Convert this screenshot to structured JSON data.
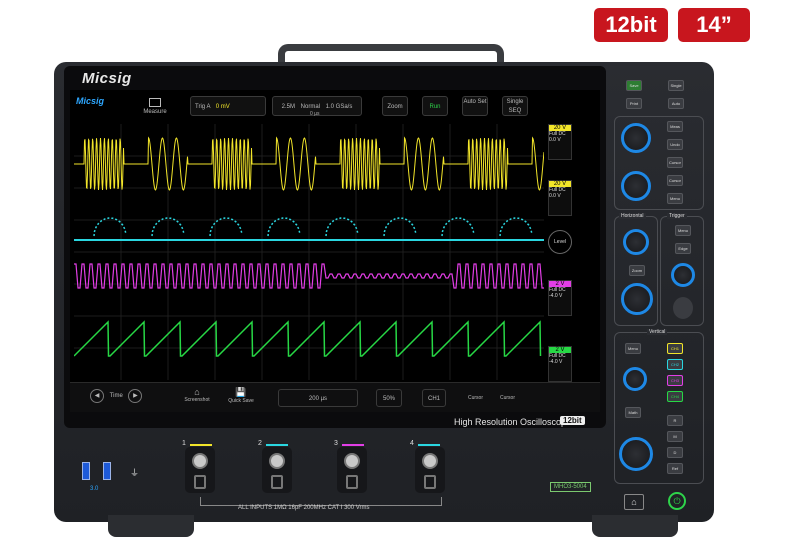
{
  "badges": {
    "bit": "12bit",
    "size": "14”"
  },
  "brand": "Micsig",
  "screen": {
    "logo": "Micsig",
    "measure_label": "Measure",
    "trigger": {
      "label": "Trig A",
      "value": "0 mV"
    },
    "timebase": {
      "samples": "2.5M",
      "mode": "Normal",
      "rate": "1.0 GSa/s",
      "delay": "0 µs"
    },
    "buttons": {
      "zoom": "Zoom",
      "run": "Run",
      "auto": "Auto Set",
      "single": "Single SEQ"
    },
    "channels": [
      {
        "scale": "20 V",
        "coupling": "Full DC",
        "offset": "0.0 V",
        "color": "#f2e52a"
      },
      {
        "scale": "20 V",
        "coupling": "Full DC",
        "offset": "0.0 V",
        "color": "#2ad6e0"
      },
      {
        "scale": "2 V",
        "coupling": "Full DC",
        "offset": "-4.0 V",
        "color": "#e23ee6"
      },
      {
        "scale": "2 V",
        "coupling": "Full DC",
        "offset": "-4.0 V",
        "color": "#27d845"
      }
    ],
    "level_label": "Level",
    "bottom": {
      "time": "Time",
      "horizontal": "200 µs",
      "percent": "50%",
      "cursor": "Cursor",
      "screenshot": "Screenshot",
      "quicksave": "Quick Save",
      "ch_off": "CH1"
    }
  },
  "subtitle": "High Resolution Oscilloscope",
  "subtitle_badge": "12bit",
  "panel": {
    "top": [
      "Save",
      "Single",
      "Print",
      "Auto"
    ],
    "multipurpose": [
      "Meas",
      "Undo",
      "Cursor",
      "Cursor",
      "Menu"
    ],
    "horizontal_title": "Horizontal",
    "trigger_title": "Trigger",
    "horizontal": [
      "Position",
      "Zoom",
      "Scale"
    ],
    "trigger": [
      "Menu",
      "Edge",
      "Level"
    ],
    "vertical_title": "Vertical",
    "vertical": [
      "Menu",
      "Position",
      "Math",
      "Scale"
    ],
    "ch_buttons": [
      "CH1",
      "CH2",
      "CH3",
      "CH4"
    ],
    "right_col": [
      "R",
      "M",
      "D",
      "Ref"
    ]
  },
  "inputs": [
    {
      "label": "1",
      "color": "#f2e52a"
    },
    {
      "label": "2",
      "color": "#2ad6e0"
    },
    {
      "label": "3",
      "color": "#e23ee6"
    },
    {
      "label": "4",
      "color": "#2ad6e0"
    }
  ],
  "input_note": "ALL INPUTS 1MΩ 16pF 200MHz CAT I    300 Vrms",
  "model": "MHO3-5004",
  "usb_label": "3.0"
}
